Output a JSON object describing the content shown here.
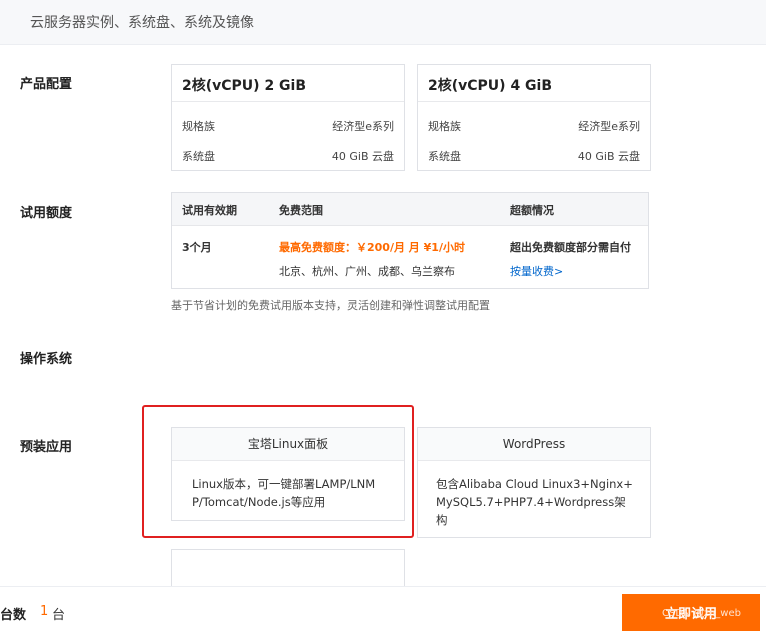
{
  "header": {
    "title": "云服务器实例、系统盘、系统及镜像"
  },
  "sections": {
    "config": "产品配置",
    "quota": "试用额度",
    "os": "操作系统",
    "apps": "预装应用"
  },
  "configs": [
    {
      "title": "2核(vCPU) 2 GiB",
      "spec_label": "规格族",
      "spec_value": "经济型e系列",
      "disk_label": "系统盘",
      "disk_value": "40 GiB 云盘"
    },
    {
      "title": "2核(vCPU) 4 GiB",
      "spec_label": "规格族",
      "spec_value": "经济型e系列",
      "disk_label": "系统盘",
      "disk_value": "40 GiB 云盘"
    }
  ],
  "quota_table": {
    "headers": [
      "试用有效期",
      "免费范围",
      "超额情况"
    ],
    "period": "3个月",
    "free_limit": "最高免费额度：￥200/月 ⽉ ¥1/小时",
    "regions": "北京、杭州、广州、成都、乌兰察布",
    "overage": "超出免费额度部分需自付",
    "overage_link": "按量收费>"
  },
  "note": "基于节省计划的免费试用版本支持，灵活创建和弹性调整试用配置",
  "apps": [
    {
      "title": "宝塔Linux面板",
      "desc_line1": "Linux版本，可一键部署LAMP/LNM",
      "desc_line2": "P/Tomcat/Node.js等应用"
    },
    {
      "title": "WordPress",
      "desc_line1": "包含Alibaba Cloud Linux3+Nginx+",
      "desc_line2": "MySQL5.7+PHP7.4+Wordpress架",
      "desc_line3": "构"
    }
  ],
  "footer": {
    "count_label": "台数",
    "count_value": "1",
    "count_unit": "台",
    "cta": "立即试用"
  },
  "watermark": "CSDN @zn_web",
  "colors": {
    "accent": "#ff6a00",
    "highlight": "#e02020",
    "link": "#0066cc"
  }
}
